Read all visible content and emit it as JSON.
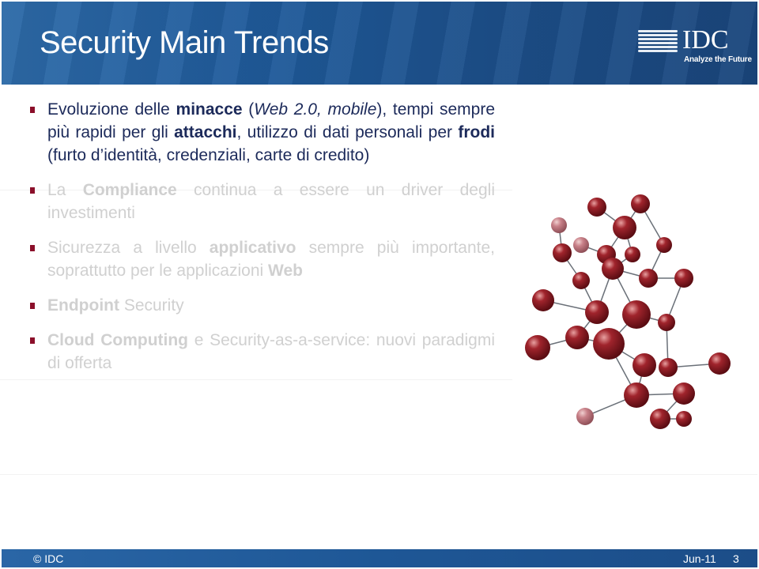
{
  "header": {
    "title": "Security Main Trends",
    "logo_text": "IDC",
    "logo_tagline": "Analyze the Future"
  },
  "bullets": [
    {
      "parts": [
        [
          "Evoluzione delle ",
          0
        ],
        [
          "minacce",
          1
        ],
        [
          " (",
          0
        ],
        [
          "Web 2.0, mobile",
          2
        ],
        [
          "), tempi sempre più rapidi per gli ",
          0
        ],
        [
          "attacchi",
          1
        ],
        [
          ", utilizzo di dati personali per ",
          0
        ],
        [
          "frodi",
          1
        ],
        [
          " (furto d’identità, credenziali, carte di credito)",
          0
        ]
      ],
      "active": true
    },
    {
      "parts": [
        [
          "La ",
          0
        ],
        [
          "Compliance",
          1
        ],
        [
          " continua a essere un driver degli investimenti",
          0
        ]
      ],
      "active": false
    },
    {
      "parts": [
        [
          "Sicurezza a livello ",
          0
        ],
        [
          "applicativo",
          1
        ],
        [
          " sempre più importante, soprattutto per le applicazioni ",
          0
        ],
        [
          "Web",
          1
        ]
      ],
      "active": false
    },
    {
      "parts": [
        [
          "Endpoint",
          1
        ],
        [
          " Security",
          0
        ]
      ],
      "active": false
    },
    {
      "parts": [
        [
          "Cloud Computing",
          1
        ],
        [
          " e Security-as-a-service: nuovi paradigmi di offerta",
          0
        ]
      ],
      "active": false
    }
  ],
  "colors": {
    "header_blue": "#1f5a9a",
    "bullet_red": "#8b0f2a",
    "active_text": "#1c2a5a",
    "inactive_text": "#d0d0d0",
    "sphere": "#8e1a24"
  },
  "footer": {
    "copyright": "© IDC",
    "date": "Jun-11",
    "page": "3"
  }
}
